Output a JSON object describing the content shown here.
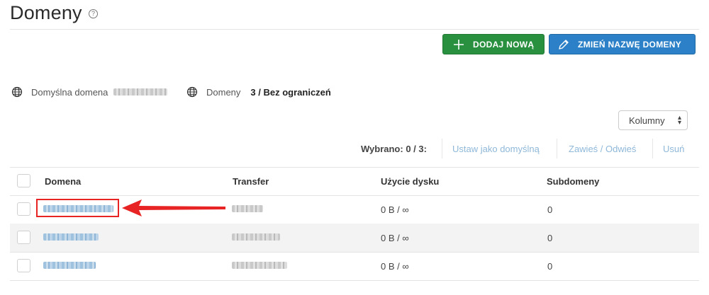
{
  "page": {
    "title": "Domeny",
    "help_glyph": "?"
  },
  "toolbar": {
    "add_label": "DODAJ NOWĄ",
    "rename_label": "ZMIEŃ NAZWĘ DOMENY"
  },
  "info": {
    "default_domain_label": "Domyślna domena",
    "domains_label": "Domeny",
    "domains_value": "3 / Bez ograniczeń"
  },
  "columns_select": {
    "label": "Kolumny"
  },
  "selection": {
    "label": "Wybrano: 0 / 3:",
    "set_default": "Ustaw jako domyślną",
    "suspend": "Zawieś / Odwieś",
    "delete": "Usuń"
  },
  "table": {
    "headers": [
      "Domena",
      "Transfer",
      "Użycie dysku",
      "Subdomeny"
    ],
    "rows": [
      {
        "disk": "0 B / ∞",
        "subdomains": "0"
      },
      {
        "disk": "0 B / ∞",
        "subdomains": "0"
      },
      {
        "disk": "0 B / ∞",
        "subdomains": "0"
      }
    ]
  },
  "colors": {
    "add": "#29903f",
    "rename": "#2b80c7",
    "highlight": "#e82323",
    "link_disabled": "#8fb8d9"
  }
}
